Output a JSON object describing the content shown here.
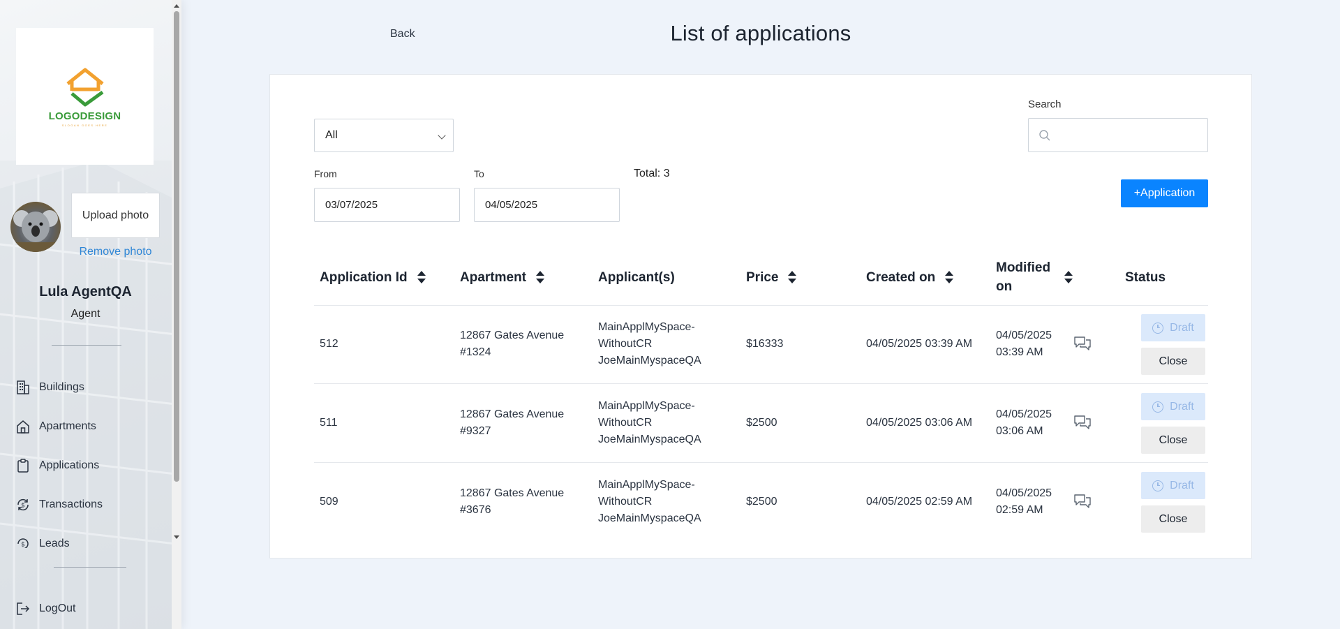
{
  "sidebar": {
    "logo": {
      "text": "LOGODESIGN",
      "subtext": "SLOGAN GOES HERE",
      "colors": {
        "orange": "#f2a12f",
        "green": "#3a9b3a"
      }
    },
    "upload_photo_label": "Upload photo",
    "remove_photo_label": "Remove photo",
    "user_name": "Lula AgentQA",
    "user_role": "Agent",
    "nav": [
      {
        "label": "Buildings",
        "icon": "building-icon"
      },
      {
        "label": "Apartments",
        "icon": "home-icon"
      },
      {
        "label": "Applications",
        "icon": "clipboard-icon"
      },
      {
        "label": "Transactions",
        "icon": "dollar-cycle-icon"
      },
      {
        "label": "Leads",
        "icon": "leads-icon"
      }
    ],
    "logout_label": "LogOut"
  },
  "header": {
    "back_label": "Back",
    "title": "List of applications"
  },
  "filters": {
    "status_select": "All",
    "search_label": "Search",
    "search_value": "",
    "from_label": "From",
    "from_value": "03/07/2025",
    "to_label": "To",
    "to_value": "04/05/2025",
    "total_text": "Total: 3",
    "add_button_label": "+Application"
  },
  "table": {
    "columns": [
      "Application Id",
      "Apartment",
      "Applicant(s)",
      "Price",
      "Created on",
      "Modified on",
      "Status"
    ],
    "rows": [
      {
        "id": "512",
        "apartment_line1": "12867 Gates Avenue",
        "apartment_line2": "#1324",
        "applicant_line1": "MainApplMySpace-",
        "applicant_line2": "WithoutCR",
        "applicant_line3": "JoeMainMyspaceQA",
        "price": "$16333",
        "created_on": "04/05/2025 03:39 AM",
        "modified_line1": "04/05/2025",
        "modified_line2": "03:39 AM",
        "status": "Draft",
        "close_label": "Close"
      },
      {
        "id": "511",
        "apartment_line1": "12867 Gates Avenue",
        "apartment_line2": "#9327",
        "applicant_line1": "MainApplMySpace-",
        "applicant_line2": "WithoutCR",
        "applicant_line3": "JoeMainMyspaceQA",
        "price": "$2500",
        "created_on": "04/05/2025 03:06 AM",
        "modified_line1": "04/05/2025",
        "modified_line2": "03:06 AM",
        "status": "Draft",
        "close_label": "Close"
      },
      {
        "id": "509",
        "apartment_line1": "12867 Gates Avenue",
        "apartment_line2": "#3676",
        "applicant_line1": "MainApplMySpace-",
        "applicant_line2": "WithoutCR",
        "applicant_line3": "JoeMainMyspaceQA",
        "price": "$2500",
        "created_on": "04/05/2025 02:59 AM",
        "modified_line1": "04/05/2025",
        "modified_line2": "02:59 AM",
        "status": "Draft",
        "close_label": "Close"
      }
    ]
  },
  "colors": {
    "accent": "#0a84ff",
    "link": "#2f86d6",
    "draft_bg": "#dbe9fb",
    "page_bg": "#eef3fa"
  }
}
